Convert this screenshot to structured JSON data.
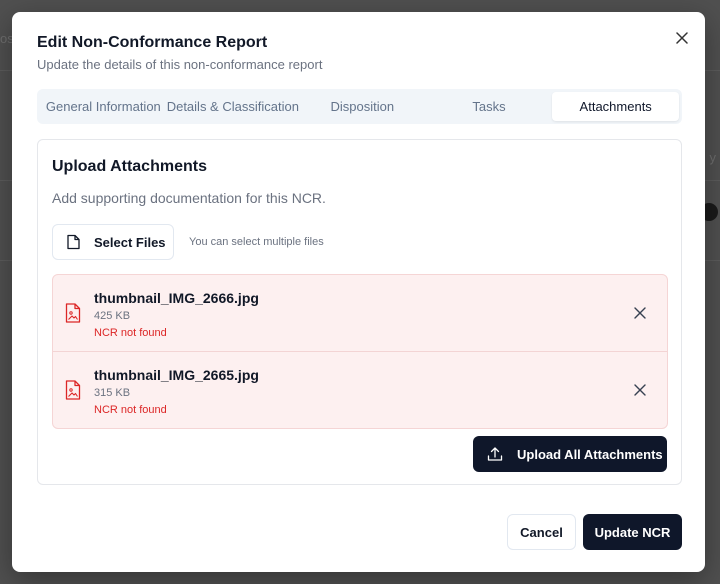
{
  "background": {
    "left_snippet": "osi",
    "right_snippet": "y"
  },
  "dialog": {
    "title": "Edit Non-Conformance Report",
    "subtitle": "Update the details of this non-conformance report",
    "close_icon": "close-icon"
  },
  "tabs": [
    {
      "label": "General Information",
      "active": false
    },
    {
      "label": "Details & Classification",
      "active": false
    },
    {
      "label": "Disposition",
      "active": false
    },
    {
      "label": "Tasks",
      "active": false
    },
    {
      "label": "Attachments",
      "active": true
    }
  ],
  "attachments": {
    "title": "Upload Attachments",
    "description": "Add supporting documentation for this NCR.",
    "select_button": "Select Files",
    "select_icon": "file-icon",
    "hint": "You can select multiple files",
    "files": [
      {
        "name": "thumbnail_IMG_2666.jpg",
        "size": "425 KB",
        "error": "NCR not found",
        "icon": "image-file-icon"
      },
      {
        "name": "thumbnail_IMG_2665.jpg",
        "size": "315 KB",
        "error": "NCR not found",
        "icon": "image-file-icon"
      }
    ],
    "upload_button": "Upload All Attachments",
    "upload_icon": "upload-icon"
  },
  "footer": {
    "cancel": "Cancel",
    "submit": "Update NCR"
  },
  "colors": {
    "primary": "#0f172a",
    "error": "#dc2626",
    "error_bg": "#fdf0f0"
  }
}
